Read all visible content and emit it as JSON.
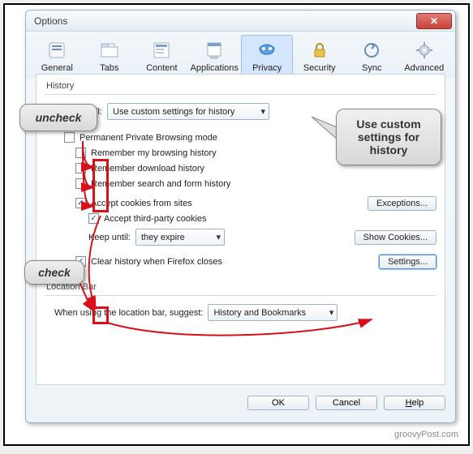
{
  "window": {
    "title": "Options"
  },
  "tabs": [
    {
      "label": "General"
    },
    {
      "label": "Tabs"
    },
    {
      "label": "Content"
    },
    {
      "label": "Applications"
    },
    {
      "label": "Privacy"
    },
    {
      "label": "Security"
    },
    {
      "label": "Sync"
    },
    {
      "label": "Advanced"
    }
  ],
  "history": {
    "section": "History",
    "will_label": "Firefox will:",
    "will_value": "Use custom settings for history",
    "permanent_pb": "Permanent Private Browsing mode",
    "remember_browsing": "Remember my browsing history",
    "remember_download": "Remember download history",
    "remember_forms": "Remember search and form history",
    "accept_cookies": "Accept cookies from sites",
    "exceptions_btn": "Exceptions...",
    "accept_third": "Accept third-party cookies",
    "keep_until_label": "Keep until:",
    "keep_until_value": "they expire",
    "show_cookies_btn": "Show Cookies...",
    "clear_on_close": "Clear history when Firefox closes",
    "settings_btn": "Settings..."
  },
  "location_bar": {
    "section": "Location Bar",
    "suggest_label": "When using the location bar, suggest:",
    "suggest_value": "History and Bookmarks"
  },
  "footer": {
    "ok": "OK",
    "cancel": "Cancel",
    "help": "Help"
  },
  "annotations": {
    "uncheck": "uncheck",
    "check": "check",
    "callout": "Use custom settings for history"
  },
  "watermark": "groovyPost.com"
}
